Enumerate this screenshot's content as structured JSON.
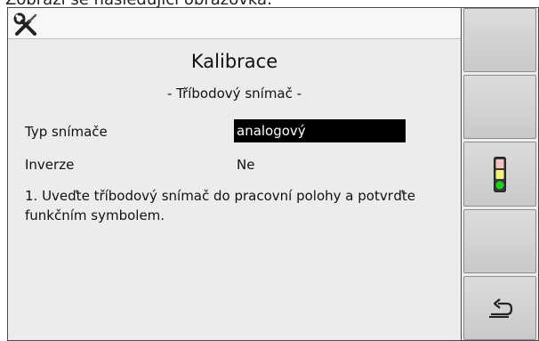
{
  "caption": "Zobrazí se následující obrazovka:",
  "header": {
    "icon": "tools-icon"
  },
  "main": {
    "title": "Kalibrace",
    "subtitle": "- Tříbodový snímač -",
    "rows": [
      {
        "label": "Typ snímače",
        "value": "analogový",
        "selected": true
      },
      {
        "label": "Inverze",
        "value": "Ne",
        "selected": false
      }
    ],
    "instruction": "1. Uveďte tříbodový snímač do pracovní polohy a potvrďte funkčním symbolem."
  },
  "softkeys": [
    {
      "icon": ""
    },
    {
      "icon": ""
    },
    {
      "icon": "traffic-light-icon"
    },
    {
      "icon": ""
    },
    {
      "icon": "return-arrow-icon"
    }
  ],
  "colors": {
    "screen_bg": "#ececec",
    "selection_bg": "#000000",
    "selection_text": "#ffffff",
    "light_green": "#1fd11f",
    "light_yellow": "#f3f37a",
    "light_red": "#f3c2c2"
  }
}
